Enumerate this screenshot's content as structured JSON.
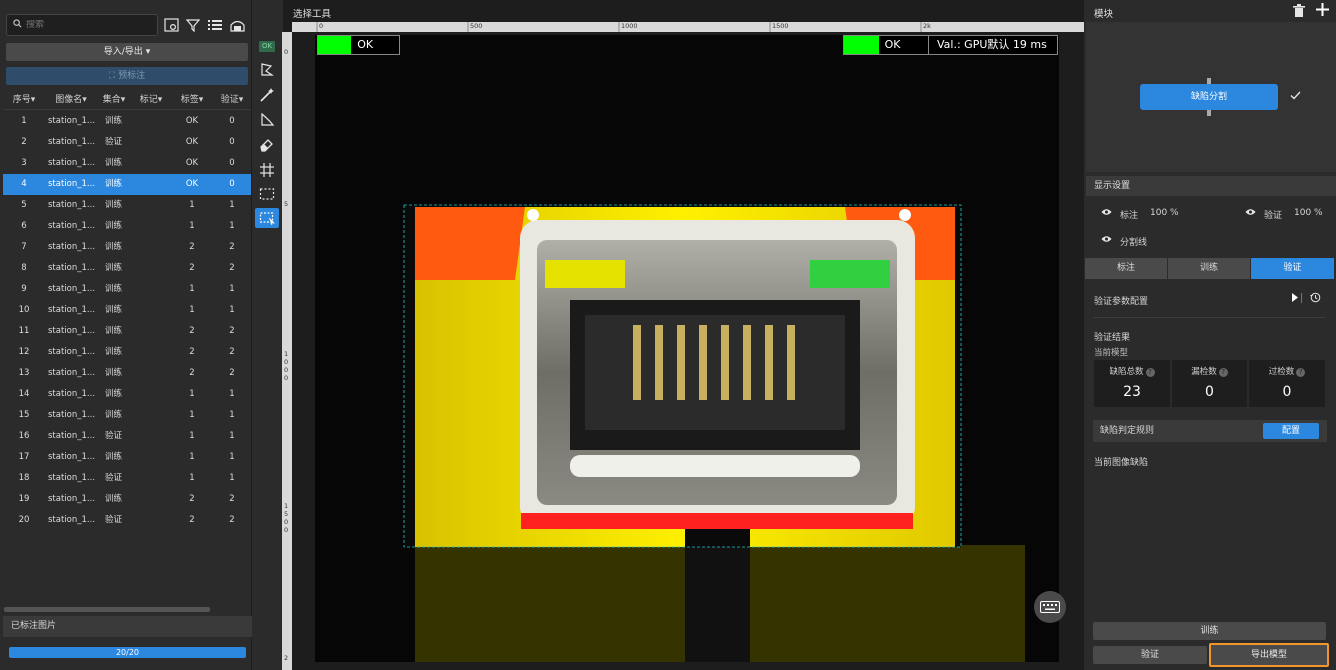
{
  "left_panel": {
    "search_placeholder": "搜索",
    "import_export_label": "导入/导出",
    "quick_label_button": "预标注",
    "columns": [
      "序号",
      "图像名",
      "集合",
      "标记",
      "标签",
      "验证"
    ],
    "rows": [
      {
        "idx": "1",
        "name": "station_1...",
        "set": "训练",
        "mark": "",
        "tag": "OK",
        "val": "0"
      },
      {
        "idx": "2",
        "name": "station_1...",
        "set": "验证",
        "mark": "",
        "tag": "OK",
        "val": "0"
      },
      {
        "idx": "3",
        "name": "station_1...",
        "set": "训练",
        "mark": "",
        "tag": "OK",
        "val": "0"
      },
      {
        "idx": "4",
        "name": "station_1...",
        "set": "训练",
        "mark": "",
        "tag": "OK",
        "val": "0"
      },
      {
        "idx": "5",
        "name": "station_1...",
        "set": "训练",
        "mark": "",
        "tag": "1",
        "val": "1"
      },
      {
        "idx": "6",
        "name": "station_1...",
        "set": "训练",
        "mark": "",
        "tag": "1",
        "val": "1"
      },
      {
        "idx": "7",
        "name": "station_1...",
        "set": "训练",
        "mark": "",
        "tag": "2",
        "val": "2"
      },
      {
        "idx": "8",
        "name": "station_1...",
        "set": "训练",
        "mark": "",
        "tag": "2",
        "val": "2"
      },
      {
        "idx": "9",
        "name": "station_1...",
        "set": "训练",
        "mark": "",
        "tag": "1",
        "val": "1"
      },
      {
        "idx": "10",
        "name": "station_1...",
        "set": "训练",
        "mark": "",
        "tag": "1",
        "val": "1"
      },
      {
        "idx": "11",
        "name": "station_1...",
        "set": "训练",
        "mark": "",
        "tag": "2",
        "val": "2"
      },
      {
        "idx": "12",
        "name": "station_1...",
        "set": "训练",
        "mark": "",
        "tag": "2",
        "val": "2"
      },
      {
        "idx": "13",
        "name": "station_1...",
        "set": "训练",
        "mark": "",
        "tag": "2",
        "val": "2"
      },
      {
        "idx": "14",
        "name": "station_1...",
        "set": "训练",
        "mark": "",
        "tag": "1",
        "val": "1"
      },
      {
        "idx": "15",
        "name": "station_1...",
        "set": "训练",
        "mark": "",
        "tag": "1",
        "val": "1"
      },
      {
        "idx": "16",
        "name": "station_1...",
        "set": "验证",
        "mark": "",
        "tag": "1",
        "val": "1"
      },
      {
        "idx": "17",
        "name": "station_1...",
        "set": "训练",
        "mark": "",
        "tag": "1",
        "val": "1"
      },
      {
        "idx": "18",
        "name": "station_1...",
        "set": "验证",
        "mark": "",
        "tag": "1",
        "val": "1"
      },
      {
        "idx": "19",
        "name": "station_1...",
        "set": "训练",
        "mark": "",
        "tag": "2",
        "val": "2"
      },
      {
        "idx": "20",
        "name": "station_1...",
        "set": "验证",
        "mark": "",
        "tag": "2",
        "val": "2"
      }
    ],
    "selected_index": 3,
    "labeled_images_label": "已标注图片",
    "progress_text": "20/20",
    "progress_fraction": 1.0
  },
  "toolstrip": {
    "ok_badge": "OK"
  },
  "center": {
    "title": "选择工具",
    "ruler_top": [
      "0",
      "500",
      "1000",
      "1500",
      "2k"
    ],
    "ruler_left": [
      "0",
      "5",
      "1",
      "0",
      "0",
      "0",
      "1",
      "5",
      "0",
      "0",
      "2"
    ],
    "result_left": "OK",
    "result_right": "OK",
    "val_text": "Val.:  GPU默认 19 ms"
  },
  "right_panel": {
    "modules_title": "模块",
    "defect_node_label": "缺陷分割",
    "display_settings_title": "显示设置",
    "annot_label": "标注",
    "annot_pct": "100 %",
    "verify_label": "验证",
    "verify_pct": "100 %",
    "seg_line_label": "分割线",
    "tabs": [
      "标注",
      "训练",
      "验证"
    ],
    "active_tab": 2,
    "param_config_label": "验证参数配置",
    "verify_result_title": "验证结果",
    "current_model_label": "当前模型",
    "stats": [
      {
        "label": "缺陷总数",
        "value": "23"
      },
      {
        "label": "漏检数",
        "value": "0"
      },
      {
        "label": "过检数",
        "value": "0"
      }
    ],
    "rule_label": "缺陷判定规则",
    "config_button": "配置",
    "current_image_defects": "当前图像缺陷",
    "train_button": "训练",
    "verify_button": "验证",
    "export_button": "导出模型"
  },
  "colors": {
    "accent": "#2c87df",
    "ok_green": "#00ff00",
    "highlight": "#f0962d"
  }
}
